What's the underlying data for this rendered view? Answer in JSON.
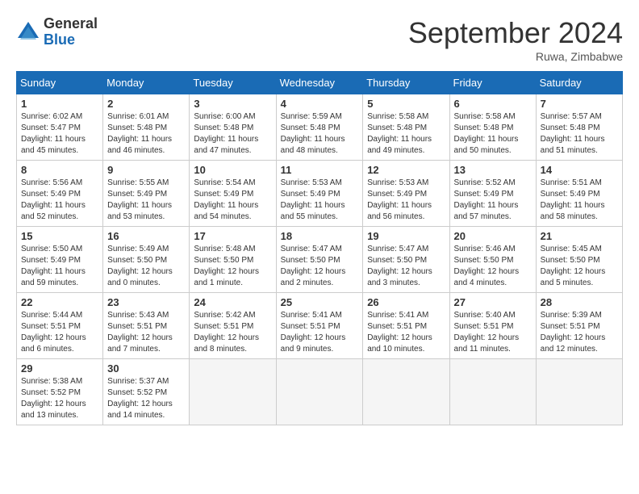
{
  "logo": {
    "general": "General",
    "blue": "Blue"
  },
  "title": "September 2024",
  "subtitle": "Ruwa, Zimbabwe",
  "headers": [
    "Sunday",
    "Monday",
    "Tuesday",
    "Wednesday",
    "Thursday",
    "Friday",
    "Saturday"
  ],
  "weeks": [
    [
      {
        "day": "1",
        "rise": "6:02 AM",
        "set": "5:47 PM",
        "daylight": "11 hours and 45 minutes."
      },
      {
        "day": "2",
        "rise": "6:01 AM",
        "set": "5:48 PM",
        "daylight": "11 hours and 46 minutes."
      },
      {
        "day": "3",
        "rise": "6:00 AM",
        "set": "5:48 PM",
        "daylight": "11 hours and 47 minutes."
      },
      {
        "day": "4",
        "rise": "5:59 AM",
        "set": "5:48 PM",
        "daylight": "11 hours and 48 minutes."
      },
      {
        "day": "5",
        "rise": "5:58 AM",
        "set": "5:48 PM",
        "daylight": "11 hours and 49 minutes."
      },
      {
        "day": "6",
        "rise": "5:58 AM",
        "set": "5:48 PM",
        "daylight": "11 hours and 50 minutes."
      },
      {
        "day": "7",
        "rise": "5:57 AM",
        "set": "5:48 PM",
        "daylight": "11 hours and 51 minutes."
      }
    ],
    [
      {
        "day": "8",
        "rise": "5:56 AM",
        "set": "5:49 PM",
        "daylight": "11 hours and 52 minutes."
      },
      {
        "day": "9",
        "rise": "5:55 AM",
        "set": "5:49 PM",
        "daylight": "11 hours and 53 minutes."
      },
      {
        "day": "10",
        "rise": "5:54 AM",
        "set": "5:49 PM",
        "daylight": "11 hours and 54 minutes."
      },
      {
        "day": "11",
        "rise": "5:53 AM",
        "set": "5:49 PM",
        "daylight": "11 hours and 55 minutes."
      },
      {
        "day": "12",
        "rise": "5:53 AM",
        "set": "5:49 PM",
        "daylight": "11 hours and 56 minutes."
      },
      {
        "day": "13",
        "rise": "5:52 AM",
        "set": "5:49 PM",
        "daylight": "11 hours and 57 minutes."
      },
      {
        "day": "14",
        "rise": "5:51 AM",
        "set": "5:49 PM",
        "daylight": "11 hours and 58 minutes."
      }
    ],
    [
      {
        "day": "15",
        "rise": "5:50 AM",
        "set": "5:49 PM",
        "daylight": "11 hours and 59 minutes."
      },
      {
        "day": "16",
        "rise": "5:49 AM",
        "set": "5:50 PM",
        "daylight": "12 hours and 0 minutes."
      },
      {
        "day": "17",
        "rise": "5:48 AM",
        "set": "5:50 PM",
        "daylight": "12 hours and 1 minute."
      },
      {
        "day": "18",
        "rise": "5:47 AM",
        "set": "5:50 PM",
        "daylight": "12 hours and 2 minutes."
      },
      {
        "day": "19",
        "rise": "5:47 AM",
        "set": "5:50 PM",
        "daylight": "12 hours and 3 minutes."
      },
      {
        "day": "20",
        "rise": "5:46 AM",
        "set": "5:50 PM",
        "daylight": "12 hours and 4 minutes."
      },
      {
        "day": "21",
        "rise": "5:45 AM",
        "set": "5:50 PM",
        "daylight": "12 hours and 5 minutes."
      }
    ],
    [
      {
        "day": "22",
        "rise": "5:44 AM",
        "set": "5:51 PM",
        "daylight": "12 hours and 6 minutes."
      },
      {
        "day": "23",
        "rise": "5:43 AM",
        "set": "5:51 PM",
        "daylight": "12 hours and 7 minutes."
      },
      {
        "day": "24",
        "rise": "5:42 AM",
        "set": "5:51 PM",
        "daylight": "12 hours and 8 minutes."
      },
      {
        "day": "25",
        "rise": "5:41 AM",
        "set": "5:51 PM",
        "daylight": "12 hours and 9 minutes."
      },
      {
        "day": "26",
        "rise": "5:41 AM",
        "set": "5:51 PM",
        "daylight": "12 hours and 10 minutes."
      },
      {
        "day": "27",
        "rise": "5:40 AM",
        "set": "5:51 PM",
        "daylight": "12 hours and 11 minutes."
      },
      {
        "day": "28",
        "rise": "5:39 AM",
        "set": "5:51 PM",
        "daylight": "12 hours and 12 minutes."
      }
    ],
    [
      {
        "day": "29",
        "rise": "5:38 AM",
        "set": "5:52 PM",
        "daylight": "12 hours and 13 minutes."
      },
      {
        "day": "30",
        "rise": "5:37 AM",
        "set": "5:52 PM",
        "daylight": "12 hours and 14 minutes."
      },
      null,
      null,
      null,
      null,
      null
    ]
  ],
  "labels": {
    "sunrise": "Sunrise:",
    "sunset": "Sunset:",
    "daylight": "Daylight:"
  }
}
